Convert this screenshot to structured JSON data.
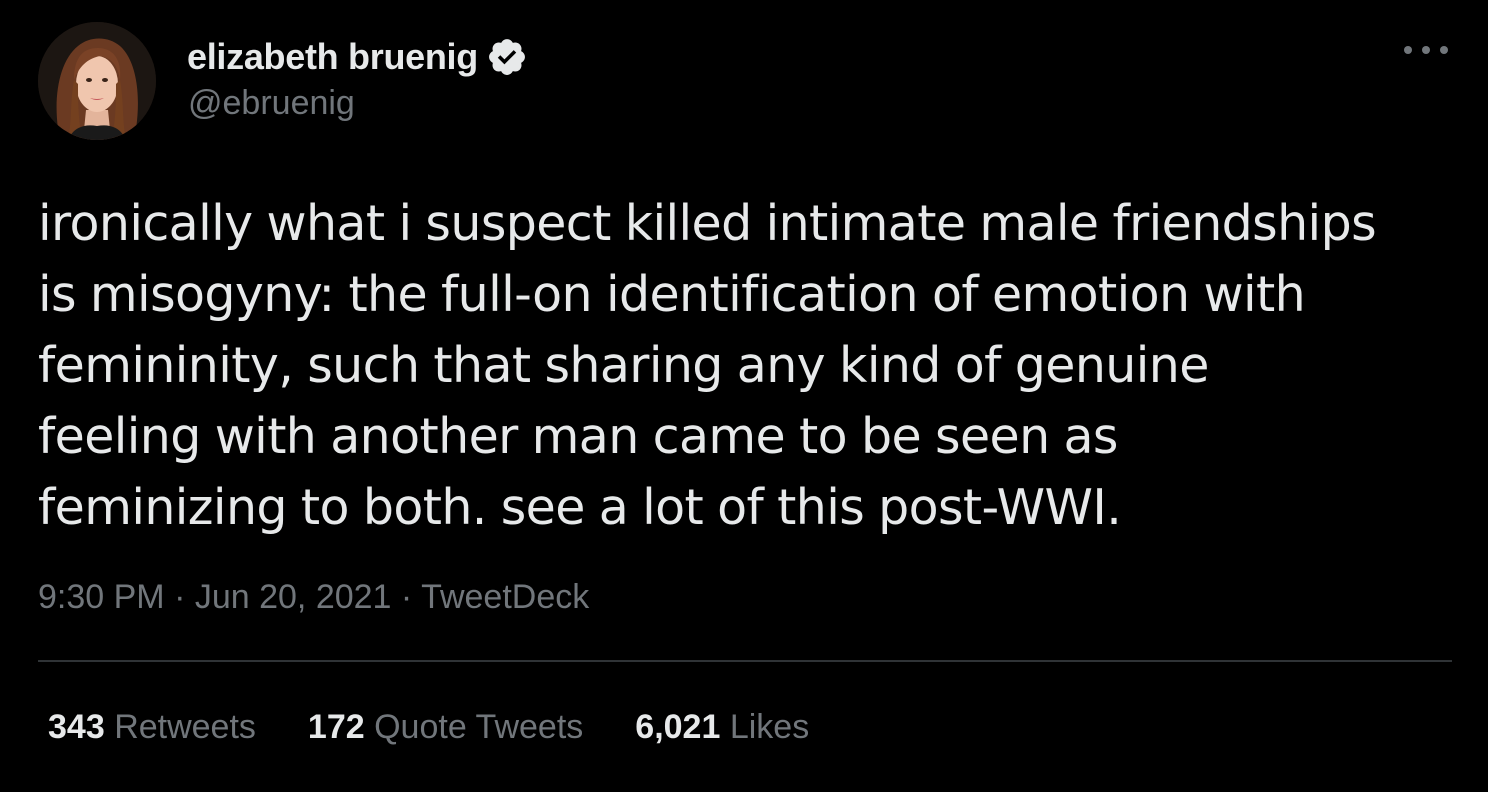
{
  "tweet": {
    "author": {
      "display_name": "elizabeth bruenig",
      "handle": "@ebruenig",
      "verified": true,
      "verified_icon": "verified-badge-icon"
    },
    "more_icon": "more-horizontal-icon",
    "lines": [
      "ironically what i suspect killed intimate male friendships",
      "is misogyny: the full-on identification of emotion with",
      "femininity, such that sharing any kind of genuine",
      "feeling with another man came to be seen as",
      "feminizing to both. see a lot of this post-WWI."
    ],
    "time": "9:30 PM",
    "separator": " · ",
    "date": "Jun 20, 2021",
    "source": "TweetDeck",
    "stats": {
      "retweets": {
        "count": "343",
        "label": "Retweets"
      },
      "quote_tweets": {
        "count": "172",
        "label": "Quote Tweets"
      },
      "likes": {
        "count": "6,021",
        "label": "Likes"
      }
    }
  },
  "colors": {
    "background": "#000000",
    "text_primary": "#e7e9ea",
    "text_secondary": "#71767b",
    "divider": "#2f3336"
  }
}
